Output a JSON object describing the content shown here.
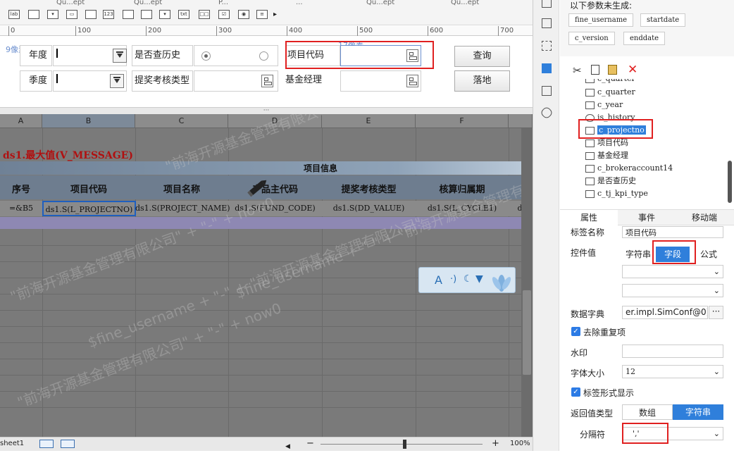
{
  "toolbar": {
    "tabs": [
      "Qu...ept",
      "Qu...ept",
      "P...",
      "...",
      "Qu...ept",
      "Qu...ept"
    ],
    "icons": [
      "label-widget-icon",
      "textfield-icon",
      "combobox-icon",
      "number-icon",
      "tree-combo-icon",
      "tree-combo-icon",
      "datetime-icon",
      "text-icon",
      "button-group-icon",
      "checkbox-group-icon",
      "more-icon"
    ]
  },
  "ruler": {
    "marks": [
      "0",
      "100",
      "200",
      "300",
      "400",
      "500",
      "600",
      "700"
    ]
  },
  "param_pane": {
    "pixel_hint_left": "9像素",
    "pixel_hint_top": "17像素",
    "labels": {
      "year": "年度",
      "history": "是否查历史",
      "project_code": "项目代码",
      "quarter": "季度",
      "reward_type": "提奖考核类型",
      "fund_manager": "基金经理"
    },
    "buttons": {
      "query": "查询",
      "export": "落地"
    }
  },
  "grid": {
    "columns": [
      "A",
      "B",
      "C",
      "D",
      "E",
      "F"
    ],
    "title": "ds1.最大值(V_MESSAGE)",
    "group_header": "项目信息",
    "headers": [
      "序号",
      "项目代码",
      "项目名称",
      "产品主代码",
      "提奖考核类型",
      "核算归属期"
    ],
    "cells": [
      "=&B5",
      "ds1.S(L_PROJECTNO)",
      "ds1.S(PROJECT_NAME)",
      "ds1.S(FUND_CODE)",
      "ds1.S(DD_VALUE)",
      "ds1.S(L_CYCLE1)",
      "d"
    ],
    "watermarks": [
      "\"前海开源基金管理有限公司\" + \"-\" + now0",
      "\"前海开源基金管理有限公司\" + \"-\" + now0",
      "$fine_username + \"-\" + \"前海开源基金管理有限公司\"",
      "\"前海开源基金管理有限公司\" + \"-\" + now0",
      "$fine_username + \"-\" + \"前海开源基金管理有限公司\""
    ],
    "ime_text": "A",
    "ime_dots": "·)"
  },
  "status": {
    "sheet": "sheet1",
    "zoom": "100%",
    "minus": "−",
    "plus": "+"
  },
  "right_panel": {
    "unset_params_title": "以下参数未生成:",
    "unset_params": [
      "fine_username",
      "startdate",
      "c_version",
      "enddate"
    ],
    "tree_items": [
      {
        "icon": "combo",
        "label": "c_quarter"
      },
      {
        "icon": "combo",
        "label": "c_year"
      },
      {
        "icon": "radio",
        "label": "is_history"
      },
      {
        "icon": "tree",
        "label": "c_projectno"
      },
      {
        "icon": "label",
        "label": "项目代码"
      },
      {
        "icon": "label",
        "label": "基金经理"
      },
      {
        "icon": "tree",
        "label": "c_brokeraccount14"
      },
      {
        "icon": "label",
        "label": "是否查历史"
      },
      {
        "icon": "tree",
        "label": "c_tj_kpi_type"
      }
    ],
    "tree_partial_top": "c_quarter",
    "tabs": [
      "属性",
      "事件",
      "移动端"
    ],
    "props": {
      "label_name_label": "标签名称",
      "label_name_value": "项目代码",
      "control_value_label": "控件值",
      "seg_string": "字符串",
      "seg_field": "字段",
      "seg_formula": "公式",
      "data_dict_label": "数据字典",
      "data_dict_value": "er.impl.SimConf@0]]",
      "dedupe_label": "去除重复项",
      "watermark_label": "水印",
      "font_size_label": "字体大小",
      "font_size_value": "12",
      "label_style_label": "标签形式显示",
      "return_type_label": "返回值类型",
      "return_array": "数组",
      "return_string": "字符串",
      "separator_label": "分隔符",
      "separator_value": "','"
    }
  }
}
